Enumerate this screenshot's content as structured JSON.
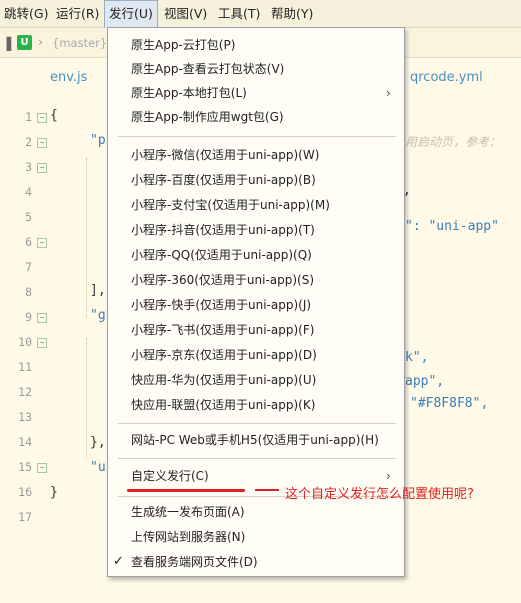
{
  "menubar": {
    "items": [
      {
        "label": "跳转(G)"
      },
      {
        "label": "运行(R)"
      },
      {
        "label": "发行(U)"
      },
      {
        "label": "视图(V)"
      },
      {
        "label": "工具(T)"
      },
      {
        "label": "帮助(Y)"
      }
    ]
  },
  "pathbar": {
    "logo": "U",
    "branch": "{master}"
  },
  "tabs": [
    {
      "label": "env.js"
    },
    {
      "label": "qrcode.yml"
    }
  ],
  "editor": {
    "line_numbers": [
      "1",
      "2",
      "3",
      "4",
      "5",
      "6",
      "7",
      "8",
      "9",
      "10",
      "11",
      "12",
      "13",
      "14",
      "15",
      "16",
      "17"
    ],
    "visible_text": {
      "l1": "{",
      "l2": "\"p",
      "l2_right": "用启动页，参考：",
      "l4": ",",
      "l6": "\": \"uni-app\"",
      "l9": "],",
      "l10": "\"g",
      "l12": "k\",",
      "l13": "app\",",
      "l14": "\"#F8F8F8\",",
      "l16": "},",
      "l17": "\"u",
      "l18": "}"
    }
  },
  "menu": {
    "groups": [
      [
        {
          "label": "原生App-云打包(P)"
        },
        {
          "label": "原生App-查看云打包状态(V)"
        },
        {
          "label": "原生App-本地打包(L)",
          "submenu": true
        },
        {
          "label": "原生App-制作应用wgt包(G)"
        }
      ],
      [
        {
          "label": "小程序-微信(仅适用于uni-app)(W)"
        },
        {
          "label": "小程序-百度(仅适用于uni-app)(B)"
        },
        {
          "label": "小程序-支付宝(仅适用于uni-app)(M)"
        },
        {
          "label": "小程序-抖音(仅适用于uni-app)(T)"
        },
        {
          "label": "小程序-QQ(仅适用于uni-app)(Q)"
        },
        {
          "label": "小程序-360(仅适用于uni-app)(S)"
        },
        {
          "label": "小程序-快手(仅适用于uni-app)(J)"
        },
        {
          "label": "小程序-飞书(仅适用于uni-app)(F)"
        },
        {
          "label": "小程序-京东(仅适用于uni-app)(D)"
        },
        {
          "label": "快应用-华为(仅适用于uni-app)(U)"
        },
        {
          "label": "快应用-联盟(仅适用于uni-app)(K)"
        }
      ],
      [
        {
          "label": "网站-PC Web或手机H5(仅适用于uni-app)(H)"
        }
      ],
      [
        {
          "label": "自定义发行(C)",
          "submenu": true
        }
      ],
      [
        {
          "label": "生成统一发布页面(A)"
        },
        {
          "label": "上传网站到服务器(N)"
        },
        {
          "label": "查看服务端网页文件(D)",
          "checked": true
        }
      ]
    ]
  },
  "annotation": {
    "text": "这个自定义发行怎么配置使用呢?",
    "color": "#e02020"
  },
  "colors": {
    "background": "#fffae8",
    "menu_background": "#fffdf5",
    "string": "#3b7db8",
    "accent_green": "#2bb24c"
  }
}
